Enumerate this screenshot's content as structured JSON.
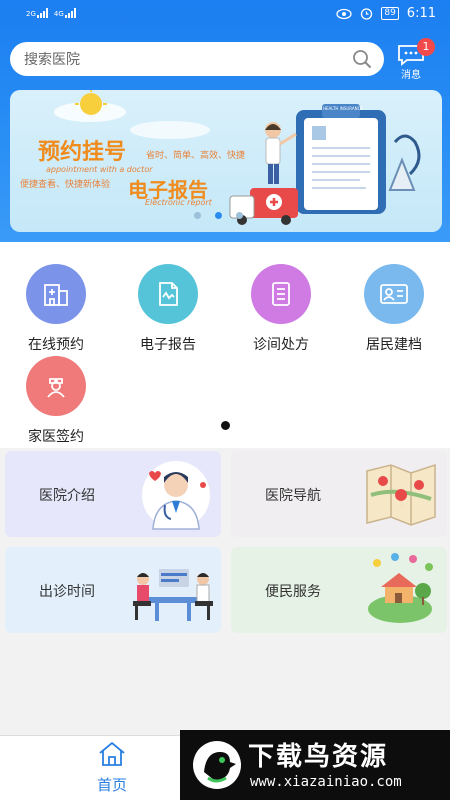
{
  "status_bar": {
    "signal1_label": "2G",
    "signal2_label": "4G",
    "battery": "89",
    "time": "6:11"
  },
  "search": {
    "placeholder": "搜索医院"
  },
  "messages": {
    "label": "消息",
    "badge": "1"
  },
  "banner": {
    "title1": "预约挂号",
    "title1_sub": "省时、简单、高效、快捷",
    "title1_en": "appointment with a doctor",
    "title2_sub": "便捷查看、快捷新体验",
    "title2": "电子报告",
    "title2_en": "Electronic report",
    "clipboard_header": "HEALTH INSURANCE",
    "active_dot": 1
  },
  "categories": [
    {
      "label": "在线预约",
      "icon": "hospital-building-icon",
      "color": "#7b93e8"
    },
    {
      "label": "电子报告",
      "icon": "report-chart-icon",
      "color": "#56c4d8"
    },
    {
      "label": "诊间处方",
      "icon": "prescription-list-icon",
      "color": "#cf7be3"
    },
    {
      "label": "居民建档",
      "icon": "id-card-icon",
      "color": "#79b9ee"
    },
    {
      "label": "家医签约",
      "icon": "doctor-nurse-icon",
      "color": "#f0797a"
    }
  ],
  "cards": [
    {
      "label": "医院介绍",
      "icon": "doctor-illustration",
      "bg": "#e6e7fb"
    },
    {
      "label": "医院导航",
      "icon": "map-illustration",
      "bg": "#f0eef0"
    },
    {
      "label": "出诊时间",
      "icon": "consultation-illustration",
      "bg": "#e3f0fb"
    },
    {
      "label": "便民服务",
      "icon": "community-illustration",
      "bg": "#e6f2e5"
    }
  ],
  "bottom_nav": {
    "home_label": "首页"
  },
  "watermark": {
    "brand": "下载鸟资源",
    "url": "www.xiazainiao.com"
  }
}
